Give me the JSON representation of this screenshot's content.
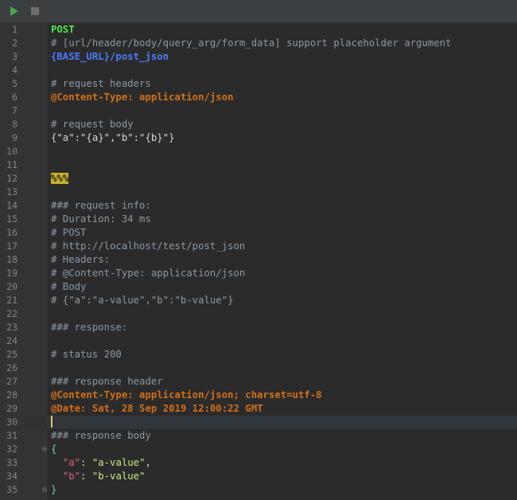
{
  "toolbar": {
    "run_icon": "play-icon",
    "stop_icon": "stop-icon",
    "run_color": "#4aa64a",
    "stop_color": "#6e6e6e"
  },
  "editor": {
    "current_line": 30,
    "lines": [
      {
        "n": "1",
        "s": [
          {
            "c": "method",
            "t": "POST"
          }
        ]
      },
      {
        "n": "2",
        "s": [
          {
            "c": "comment",
            "t": "# [url/header/body/query_arg/form_data] support placeholder argument"
          }
        ]
      },
      {
        "n": "3",
        "s": [
          {
            "c": "url",
            "t": "{BASE_URL}/post_json"
          }
        ]
      },
      {
        "n": "4",
        "s": []
      },
      {
        "n": "5",
        "s": [
          {
            "c": "comment",
            "t": "# request headers"
          }
        ]
      },
      {
        "n": "6",
        "s": [
          {
            "c": "header",
            "t": "@Content-Type: application/json"
          }
        ]
      },
      {
        "n": "7",
        "s": []
      },
      {
        "n": "8",
        "s": [
          {
            "c": "comment",
            "t": "# request body"
          }
        ]
      },
      {
        "n": "9",
        "s": [
          {
            "c": "text",
            "t": "{\"a\":\"{a}\",\"b\":\"{b}\"}"
          }
        ]
      },
      {
        "n": "10",
        "s": []
      },
      {
        "n": "11",
        "s": []
      },
      {
        "n": "12",
        "s": [
          {
            "c": "sep",
            "t": "%%%"
          }
        ]
      },
      {
        "n": "13",
        "s": []
      },
      {
        "n": "14",
        "s": [
          {
            "c": "comment",
            "t": "### request info:"
          }
        ]
      },
      {
        "n": "15",
        "s": [
          {
            "c": "comment",
            "t": "# Duration: 34 ms"
          }
        ]
      },
      {
        "n": "16",
        "s": [
          {
            "c": "comment",
            "t": "# POST"
          }
        ]
      },
      {
        "n": "17",
        "s": [
          {
            "c": "comment",
            "t": "# http://localhost/test/post_json"
          }
        ]
      },
      {
        "n": "18",
        "s": [
          {
            "c": "comment",
            "t": "# Headers:"
          }
        ]
      },
      {
        "n": "19",
        "s": [
          {
            "c": "comment",
            "t": "# @Content-Type: application/json"
          }
        ]
      },
      {
        "n": "20",
        "s": [
          {
            "c": "comment",
            "t": "# Body"
          }
        ]
      },
      {
        "n": "21",
        "s": [
          {
            "c": "comment",
            "t": "# {\"a\":\"a-value\",\"b\":\"b-value\"}"
          }
        ]
      },
      {
        "n": "22",
        "s": []
      },
      {
        "n": "23",
        "s": [
          {
            "c": "comment",
            "t": "### response:"
          }
        ]
      },
      {
        "n": "24",
        "s": []
      },
      {
        "n": "25",
        "s": [
          {
            "c": "comment",
            "t": "# status 200"
          }
        ]
      },
      {
        "n": "26",
        "s": []
      },
      {
        "n": "27",
        "s": [
          {
            "c": "comment",
            "t": "### response header"
          }
        ]
      },
      {
        "n": "28",
        "s": [
          {
            "c": "header",
            "t": "@Content-Type: application/json; charset=utf-8"
          }
        ]
      },
      {
        "n": "29",
        "s": [
          {
            "c": "header",
            "t": "@Date: Sat, 28 Sep 2019 12:00:22 GMT"
          }
        ]
      },
      {
        "n": "30",
        "s": [],
        "caret": true
      },
      {
        "n": "31",
        "s": [
          {
            "c": "comment",
            "t": "### response body"
          }
        ]
      },
      {
        "n": "32",
        "fold": "⊖",
        "s": [
          {
            "c": "brace",
            "t": "{"
          }
        ]
      },
      {
        "n": "33",
        "s": [
          {
            "c": "text",
            "t": "  "
          },
          {
            "c": "key",
            "t": "\"a\""
          },
          {
            "c": "punc",
            "t": ": "
          },
          {
            "c": "str",
            "t": "\"a-value\""
          },
          {
            "c": "punc",
            "t": ","
          }
        ]
      },
      {
        "n": "34",
        "s": [
          {
            "c": "text",
            "t": "  "
          },
          {
            "c": "key",
            "t": "\"b\""
          },
          {
            "c": "punc",
            "t": ": "
          },
          {
            "c": "str",
            "t": "\"b-value\""
          }
        ]
      },
      {
        "n": "35",
        "fold": "⊖",
        "s": [
          {
            "c": "brace",
            "t": "}"
          }
        ]
      }
    ]
  }
}
